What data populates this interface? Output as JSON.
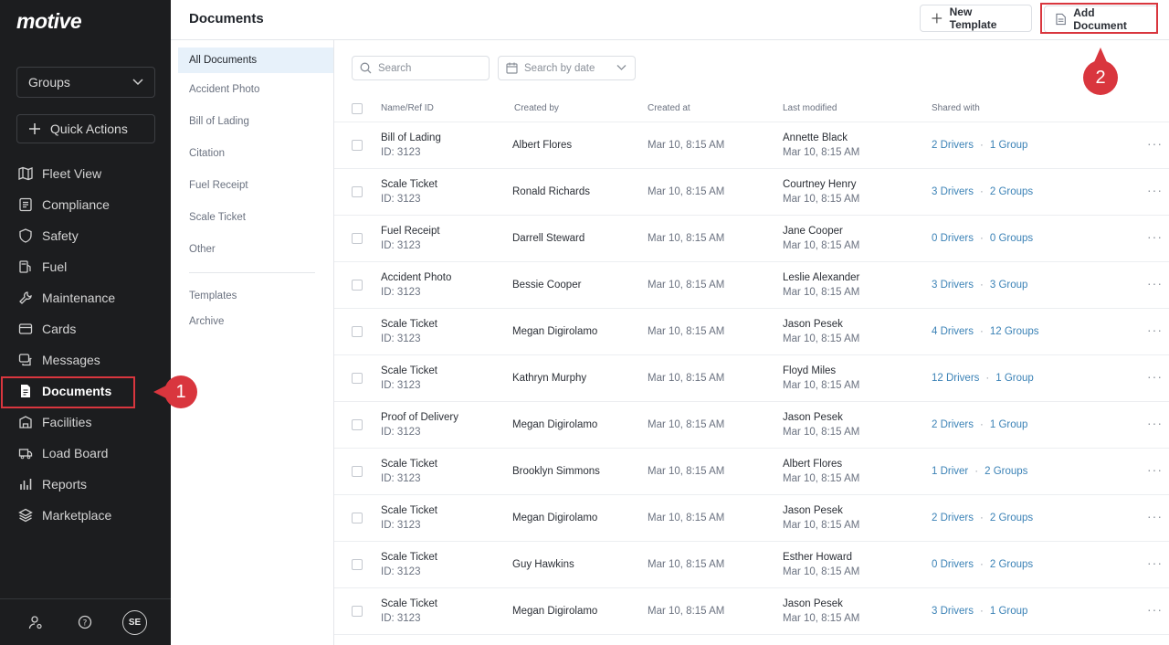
{
  "app": {
    "logo": "motive",
    "groups_label": "Groups",
    "quick_actions_label": "Quick Actions",
    "nav": [
      {
        "label": "Fleet View",
        "icon": "map-icon"
      },
      {
        "label": "Compliance",
        "icon": "clipboard-icon"
      },
      {
        "label": "Safety",
        "icon": "shield-icon"
      },
      {
        "label": "Fuel",
        "icon": "fuel-pump-icon"
      },
      {
        "label": "Maintenance",
        "icon": "wrench-icon"
      },
      {
        "label": "Cards",
        "icon": "card-icon"
      },
      {
        "label": "Messages",
        "icon": "messages-icon"
      },
      {
        "label": "Documents",
        "icon": "document-icon",
        "active": true
      },
      {
        "label": "Facilities",
        "icon": "building-icon"
      },
      {
        "label": "Load Board",
        "icon": "truck-icon"
      },
      {
        "label": "Reports",
        "icon": "bar-chart-icon"
      },
      {
        "label": "Marketplace",
        "icon": "layers-icon"
      }
    ],
    "avatar_initials": "SE"
  },
  "header": {
    "title": "Documents",
    "new_template_label": "New Template",
    "add_document_label": "Add Document"
  },
  "markers": {
    "one": "1",
    "two": "2"
  },
  "subnav": {
    "categories": [
      "All Documents",
      "Accident Photo",
      "Bill of Lading",
      "Citation",
      "Fuel Receipt",
      "Scale Ticket",
      "Other"
    ],
    "extras": [
      "Templates",
      "Archive"
    ]
  },
  "filters": {
    "search_placeholder": "Search",
    "date_placeholder": "Search by date"
  },
  "table": {
    "headers": [
      "Name/Ref ID",
      "Created by",
      "Created at",
      "Last modified",
      "Shared with"
    ],
    "rows": [
      {
        "name": "Bill of Lading",
        "id": "ID: 3123",
        "created_by": "Albert Flores",
        "created_at": "Mar 10, 8:15 AM",
        "mod_by": "Annette Black",
        "mod_at": "Mar 10, 8:15 AM",
        "drivers": "2 Drivers",
        "groups": "1 Group"
      },
      {
        "name": "Scale Ticket",
        "id": "ID: 3123",
        "created_by": "Ronald Richards",
        "created_at": "Mar 10, 8:15 AM",
        "mod_by": "Courtney Henry",
        "mod_at": "Mar 10, 8:15 AM",
        "drivers": "3 Drivers",
        "groups": "2 Groups"
      },
      {
        "name": "Fuel Receipt",
        "id": "ID: 3123",
        "created_by": "Darrell Steward",
        "created_at": "Mar 10, 8:15 AM",
        "mod_by": "Jane Cooper",
        "mod_at": "Mar 10, 8:15 AM",
        "drivers": "0 Drivers",
        "groups": "0 Groups"
      },
      {
        "name": "Accident Photo",
        "id": "ID: 3123",
        "created_by": "Bessie Cooper",
        "created_at": "Mar 10, 8:15 AM",
        "mod_by": "Leslie Alexander",
        "mod_at": "Mar 10, 8:15 AM",
        "drivers": "3 Drivers",
        "groups": "3 Group"
      },
      {
        "name": "Scale Ticket",
        "id": "ID: 3123",
        "created_by": "Megan Digirolamo",
        "created_at": "Mar 10, 8:15 AM",
        "mod_by": "Jason Pesek",
        "mod_at": "Mar 10, 8:15 AM",
        "drivers": "4 Drivers",
        "groups": "12 Groups"
      },
      {
        "name": "Scale Ticket",
        "id": "ID: 3123",
        "created_by": "Kathryn Murphy",
        "created_at": "Mar 10, 8:15 AM",
        "mod_by": "Floyd Miles",
        "mod_at": "Mar 10, 8:15 AM",
        "drivers": "12 Drivers",
        "groups": "1 Group"
      },
      {
        "name": "Proof of Delivery",
        "id": "ID: 3123",
        "created_by": "Megan Digirolamo",
        "created_at": "Mar 10, 8:15 AM",
        "mod_by": "Jason Pesek",
        "mod_at": "Mar 10, 8:15 AM",
        "drivers": "2 Drivers",
        "groups": "1 Group"
      },
      {
        "name": "Scale Ticket",
        "id": "ID: 3123",
        "created_by": "Brooklyn Simmons",
        "created_at": "Mar 10, 8:15 AM",
        "mod_by": "Albert Flores",
        "mod_at": "Mar 10, 8:15 AM",
        "drivers": "1 Driver",
        "groups": "2 Groups"
      },
      {
        "name": "Scale Ticket",
        "id": "ID: 3123",
        "created_by": "Megan Digirolamo",
        "created_at": "Mar 10, 8:15 AM",
        "mod_by": "Jason Pesek",
        "mod_at": "Mar 10, 8:15 AM",
        "drivers": "2 Drivers",
        "groups": "2 Groups"
      },
      {
        "name": "Scale Ticket",
        "id": "ID: 3123",
        "created_by": "Guy Hawkins",
        "created_at": "Mar 10, 8:15 AM",
        "mod_by": "Esther Howard",
        "mod_at": "Mar 10, 8:15 AM",
        "drivers": "0 Drivers",
        "groups": "2 Groups"
      },
      {
        "name": "Scale Ticket",
        "id": "ID: 3123",
        "created_by": "Megan Digirolamo",
        "created_at": "Mar 10, 8:15 AM",
        "mod_by": "Jason Pesek",
        "mod_at": "Mar 10, 8:15 AM",
        "drivers": "3 Drivers",
        "groups": "1 Group"
      }
    ],
    "separator": "·",
    "more_label": "···"
  },
  "colors": {
    "sidebar_bg": "#1c1d1f",
    "highlight": "#d9363e",
    "link": "#3b82b6",
    "active_bg": "#e7f1fa"
  }
}
